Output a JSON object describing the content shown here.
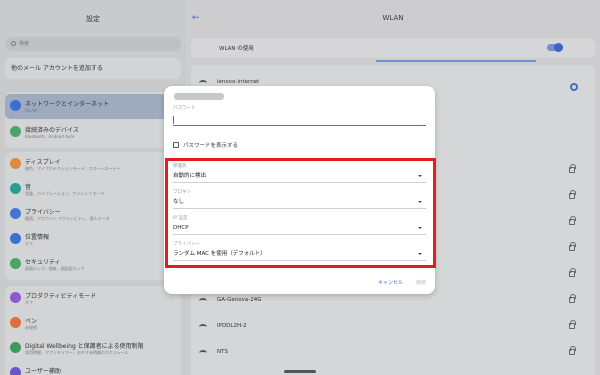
{
  "left_pane": {
    "title": "設定",
    "search_placeholder": "検索",
    "email_card": "他のメール アカウントを追加する",
    "items": [
      {
        "title": "ネットワークとインターネット",
        "subtitle": "WLAN",
        "color": "#3c6fd1"
      },
      {
        "title": "接続済みのデバイス",
        "subtitle": "Bluetooth、Android Auto",
        "color": "#4aa468"
      },
      {
        "title": "ディスプレイ",
        "subtitle": "暗色、アイプロテクションモード、スマートローテー",
        "color": "#e0883b"
      },
      {
        "title": "音",
        "subtitle": "音量、バイブレーション、サイレントモード",
        "color": "#2a9e8d"
      },
      {
        "title": "プライバシー",
        "subtitle": "権限、アカウント アクティビティ、個人データ",
        "color": "#4673d4"
      },
      {
        "title": "位置情報",
        "subtitle": "オフ",
        "color": "#3c6fd1"
      },
      {
        "title": "セキュリティ",
        "subtitle": "画面ロック、指紋、顔認証ロック",
        "color": "#4aa468"
      },
      {
        "title": "プロダクティビティモード",
        "subtitle": "オフ",
        "color": "#8a5bd0"
      },
      {
        "title": "ペン",
        "subtitle": "未接続",
        "color": "#e06d3b"
      },
      {
        "title": "Digital Wellbeing と保護者による使用制限",
        "subtitle": "利用時間、アプリタイマー、おやすみ時間のスケジュール",
        "color": "#3d9a5c"
      },
      {
        "title": "ユーザー補助",
        "subtitle": "",
        "color": "#6a55c8"
      }
    ]
  },
  "right_pane": {
    "title": "WLAN",
    "back_icon": "arrow-left-icon",
    "wlan_toggle_label": "WLAN の使用",
    "wlan_enabled": true,
    "accent": "#4b6cc0",
    "networks": [
      "lenovo-internet",
      "",
      "",
      "",
      "",
      "",
      "",
      "",
      "GA-Genova-24G",
      "IPDDL2H-2",
      "NTS",
      ""
    ]
  },
  "dialog": {
    "password_label": "パスワード",
    "show_password_label": "パスワードを表示する",
    "security_label": "保護状",
    "security_value": "自動的に検出",
    "proxy_label": "プロキシ",
    "proxy_value": "なし",
    "ip_label": "IP 設定",
    "ip_value": "DHCP",
    "privacy_label": "プライバシー",
    "privacy_value": "ランダム MAC を使用（デフォルト）",
    "cancel_label": "キャンセル",
    "connect_label": "接続",
    "highlight_color": "#e11d1d"
  }
}
